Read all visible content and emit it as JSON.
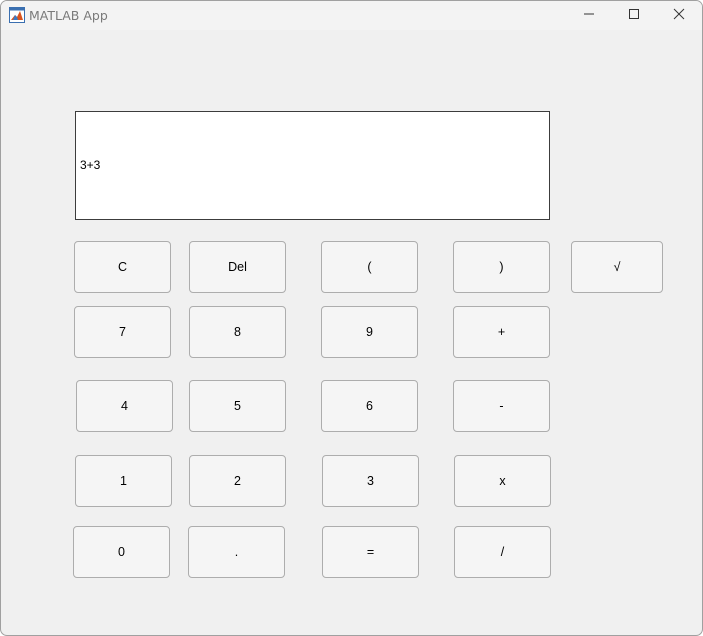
{
  "window": {
    "title": "MATLAB App"
  },
  "display": {
    "expression": "3+3"
  },
  "buttons": {
    "clear": "C",
    "delete": "Del",
    "open_paren": "(",
    "close_paren": ")",
    "sqrt": "√",
    "seven": "7",
    "eight": "8",
    "nine": "9",
    "plus": "+",
    "four": "4",
    "five": "5",
    "six": "6",
    "minus": "-",
    "one": "1",
    "two": "2",
    "three": "3",
    "multiply": "x",
    "zero": "0",
    "decimal": ".",
    "equals": "=",
    "divide": "/"
  },
  "icons": {
    "app": "matlab-logo-icon",
    "minimize": "minimize-icon",
    "maximize": "maximize-icon",
    "close": "close-icon"
  }
}
